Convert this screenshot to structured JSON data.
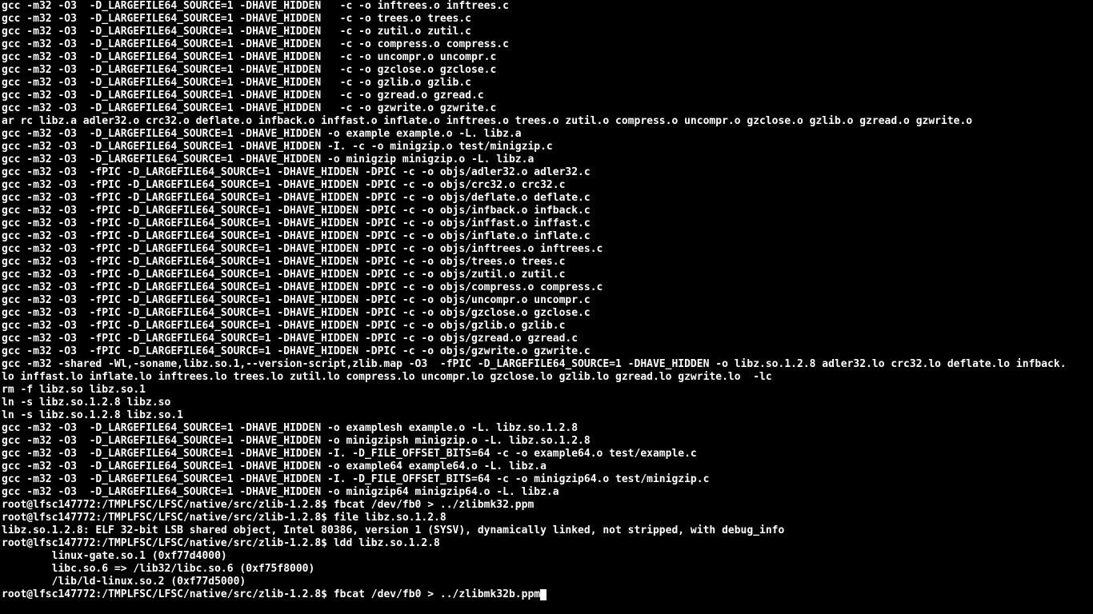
{
  "prompt": "root@lfsc147772:/TMPLFSC/LFSC/native/src/zlib-1.2.8$",
  "lines": [
    "gcc -m32 -O3  -D_LARGEFILE64_SOURCE=1 -DHAVE_HIDDEN   -c -o inftrees.o inftrees.c",
    "gcc -m32 -O3  -D_LARGEFILE64_SOURCE=1 -DHAVE_HIDDEN   -c -o trees.o trees.c",
    "gcc -m32 -O3  -D_LARGEFILE64_SOURCE=1 -DHAVE_HIDDEN   -c -o zutil.o zutil.c",
    "gcc -m32 -O3  -D_LARGEFILE64_SOURCE=1 -DHAVE_HIDDEN   -c -o compress.o compress.c",
    "gcc -m32 -O3  -D_LARGEFILE64_SOURCE=1 -DHAVE_HIDDEN   -c -o uncompr.o uncompr.c",
    "gcc -m32 -O3  -D_LARGEFILE64_SOURCE=1 -DHAVE_HIDDEN   -c -o gzclose.o gzclose.c",
    "gcc -m32 -O3  -D_LARGEFILE64_SOURCE=1 -DHAVE_HIDDEN   -c -o gzlib.o gzlib.c",
    "gcc -m32 -O3  -D_LARGEFILE64_SOURCE=1 -DHAVE_HIDDEN   -c -o gzread.o gzread.c",
    "gcc -m32 -O3  -D_LARGEFILE64_SOURCE=1 -DHAVE_HIDDEN   -c -o gzwrite.o gzwrite.c",
    "ar rc libz.a adler32.o crc32.o deflate.o infback.o inffast.o inflate.o inftrees.o trees.o zutil.o compress.o uncompr.o gzclose.o gzlib.o gzread.o gzwrite.o ",
    "gcc -m32 -O3  -D_LARGEFILE64_SOURCE=1 -DHAVE_HIDDEN -o example example.o -L. libz.a",
    "gcc -m32 -O3  -D_LARGEFILE64_SOURCE=1 -DHAVE_HIDDEN -I. -c -o minigzip.o test/minigzip.c",
    "gcc -m32 -O3  -D_LARGEFILE64_SOURCE=1 -DHAVE_HIDDEN -o minigzip minigzip.o -L. libz.a",
    "gcc -m32 -O3  -fPIC -D_LARGEFILE64_SOURCE=1 -DHAVE_HIDDEN -DPIC -c -o objs/adler32.o adler32.c",
    "gcc -m32 -O3  -fPIC -D_LARGEFILE64_SOURCE=1 -DHAVE_HIDDEN -DPIC -c -o objs/crc32.o crc32.c",
    "gcc -m32 -O3  -fPIC -D_LARGEFILE64_SOURCE=1 -DHAVE_HIDDEN -DPIC -c -o objs/deflate.o deflate.c",
    "gcc -m32 -O3  -fPIC -D_LARGEFILE64_SOURCE=1 -DHAVE_HIDDEN -DPIC -c -o objs/infback.o infback.c",
    "gcc -m32 -O3  -fPIC -D_LARGEFILE64_SOURCE=1 -DHAVE_HIDDEN -DPIC -c -o objs/inffast.o inffast.c",
    "gcc -m32 -O3  -fPIC -D_LARGEFILE64_SOURCE=1 -DHAVE_HIDDEN -DPIC -c -o objs/inflate.o inflate.c",
    "gcc -m32 -O3  -fPIC -D_LARGEFILE64_SOURCE=1 -DHAVE_HIDDEN -DPIC -c -o objs/inftrees.o inftrees.c",
    "gcc -m32 -O3  -fPIC -D_LARGEFILE64_SOURCE=1 -DHAVE_HIDDEN -DPIC -c -o objs/trees.o trees.c",
    "gcc -m32 -O3  -fPIC -D_LARGEFILE64_SOURCE=1 -DHAVE_HIDDEN -DPIC -c -o objs/zutil.o zutil.c",
    "gcc -m32 -O3  -fPIC -D_LARGEFILE64_SOURCE=1 -DHAVE_HIDDEN -DPIC -c -o objs/compress.o compress.c",
    "gcc -m32 -O3  -fPIC -D_LARGEFILE64_SOURCE=1 -DHAVE_HIDDEN -DPIC -c -o objs/uncompr.o uncompr.c",
    "gcc -m32 -O3  -fPIC -D_LARGEFILE64_SOURCE=1 -DHAVE_HIDDEN -DPIC -c -o objs/gzclose.o gzclose.c",
    "gcc -m32 -O3  -fPIC -D_LARGEFILE64_SOURCE=1 -DHAVE_HIDDEN -DPIC -c -o objs/gzlib.o gzlib.c",
    "gcc -m32 -O3  -fPIC -D_LARGEFILE64_SOURCE=1 -DHAVE_HIDDEN -DPIC -c -o objs/gzread.o gzread.c",
    "gcc -m32 -O3  -fPIC -D_LARGEFILE64_SOURCE=1 -DHAVE_HIDDEN -DPIC -c -o objs/gzwrite.o gzwrite.c",
    "gcc -m32 -shared -Wl,-soname,libz.so.1,--version-script,zlib.map -O3  -fPIC -D_LARGEFILE64_SOURCE=1 -DHAVE_HIDDEN -o libz.so.1.2.8 adler32.lo crc32.lo deflate.lo infback.",
    "lo inffast.lo inflate.lo inftrees.lo trees.lo zutil.lo compress.lo uncompr.lo gzclose.lo gzlib.lo gzread.lo gzwrite.lo  -lc ",
    "rm -f libz.so libz.so.1",
    "ln -s libz.so.1.2.8 libz.so",
    "ln -s libz.so.1.2.8 libz.so.1",
    "gcc -m32 -O3  -D_LARGEFILE64_SOURCE=1 -DHAVE_HIDDEN -o examplesh example.o -L. libz.so.1.2.8",
    "gcc -m32 -O3  -D_LARGEFILE64_SOURCE=1 -DHAVE_HIDDEN -o minigzipsh minigzip.o -L. libz.so.1.2.8",
    "gcc -m32 -O3  -D_LARGEFILE64_SOURCE=1 -DHAVE_HIDDEN -I. -D_FILE_OFFSET_BITS=64 -c -o example64.o test/example.c",
    "gcc -m32 -O3  -D_LARGEFILE64_SOURCE=1 -DHAVE_HIDDEN -o example64 example64.o -L. libz.a",
    "gcc -m32 -O3  -D_LARGEFILE64_SOURCE=1 -DHAVE_HIDDEN -I. -D_FILE_OFFSET_BITS=64 -c -o minigzip64.o test/minigzip.c",
    "gcc -m32 -O3  -D_LARGEFILE64_SOURCE=1 -DHAVE_HIDDEN -o minigzip64 minigzip64.o -L. libz.a"
  ],
  "cmds": [
    {
      "cmd": "fbcat /dev/fb0 > ../zlibmk32.ppm",
      "out": []
    },
    {
      "cmd": "file libz.so.1.2.8",
      "out": [
        "libz.so.1.2.8: ELF 32-bit LSB shared object, Intel 80386, version 1 (SYSV), dynamically linked, not stripped, with debug_info"
      ]
    },
    {
      "cmd": "ldd libz.so.1.2.8",
      "out": [
        "        linux-gate.so.1 (0xf77d4000)",
        "        libc.so.6 => /lib32/libc.so.6 (0xf75f8000)",
        "        /lib/ld-linux.so.2 (0xf77d5000)"
      ]
    }
  ],
  "current_cmd": "fbcat /dev/fb0 > ../zlibmk32b.ppm"
}
